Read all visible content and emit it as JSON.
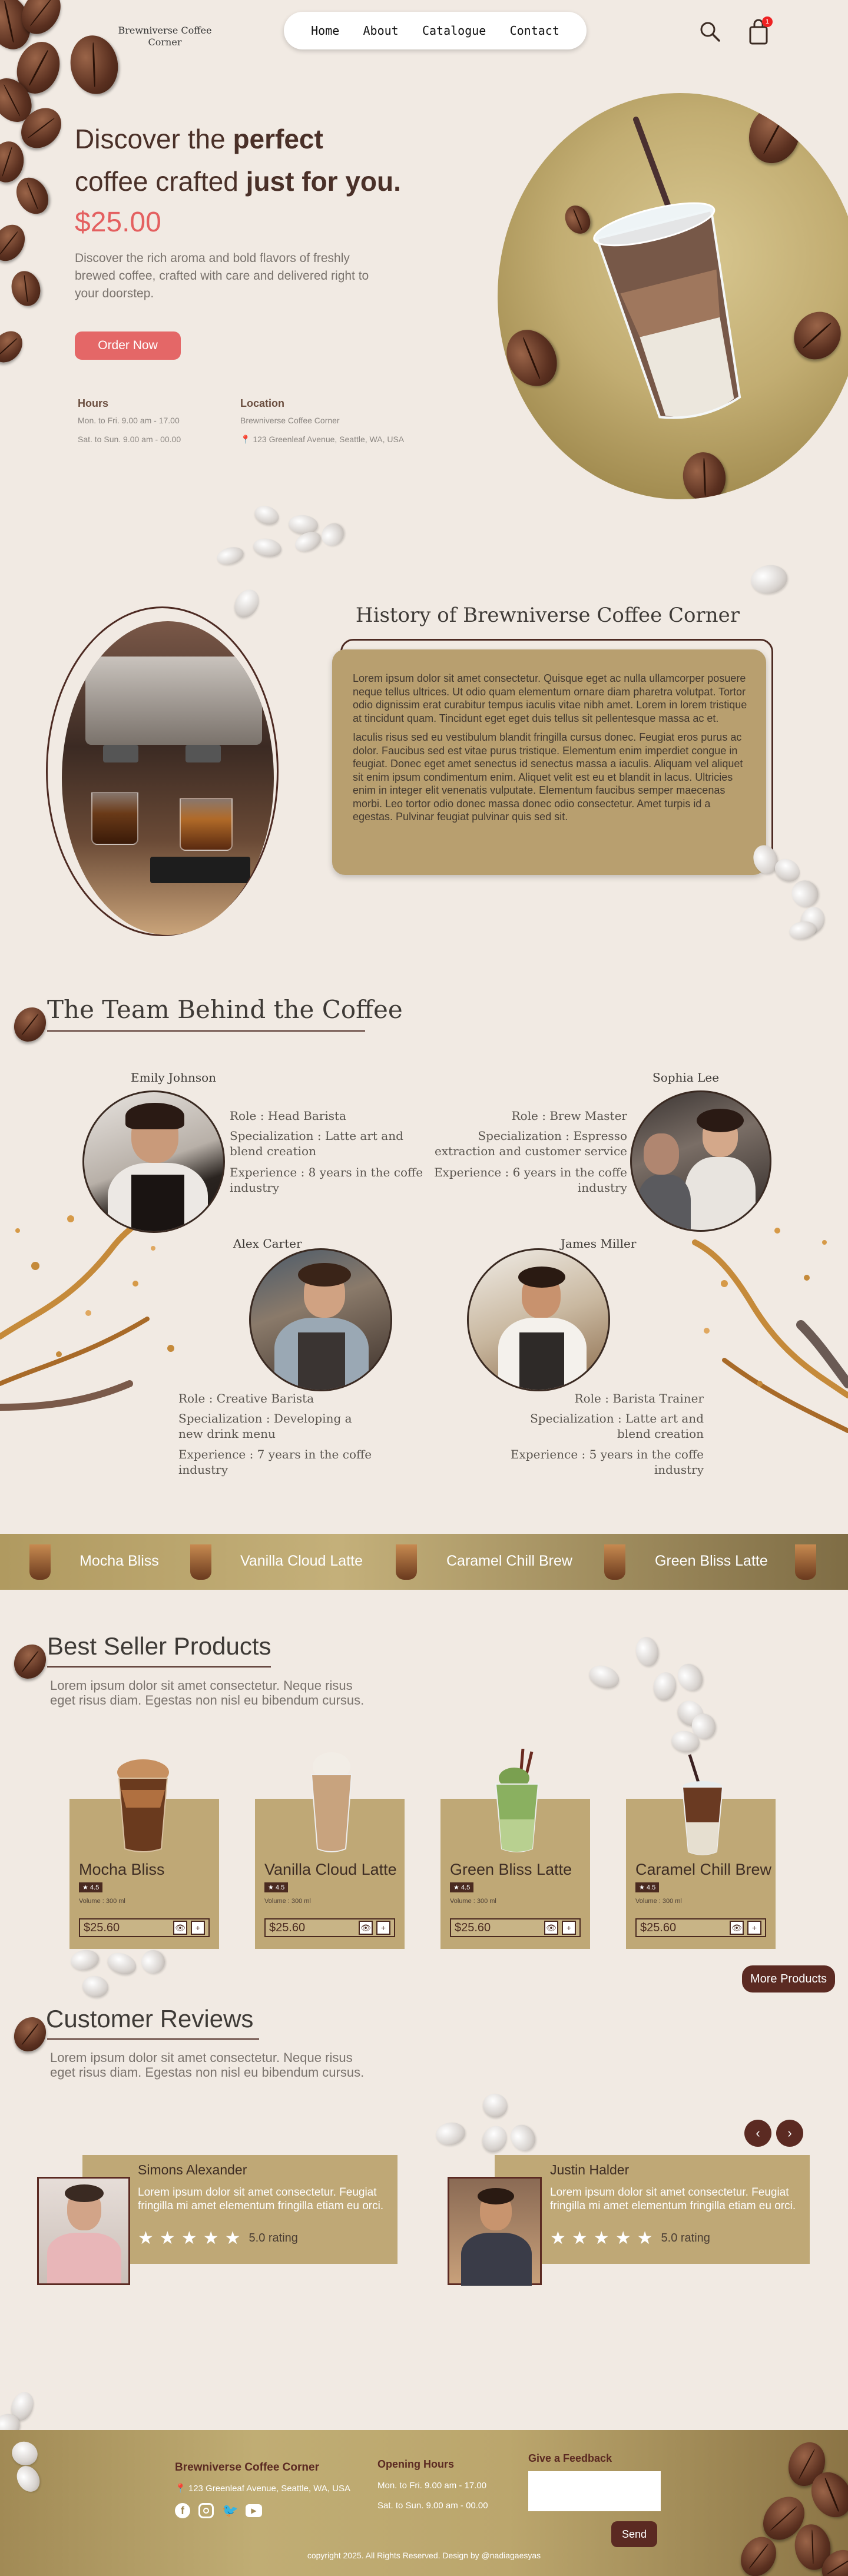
{
  "brand": {
    "name_line1": "Brewniverse Coffee",
    "name_line2": "Corner"
  },
  "nav": {
    "items": [
      "Home",
      "About",
      "Catalogue",
      "Contact"
    ],
    "cart_count": "1"
  },
  "hero": {
    "headline_1": "Discover the ",
    "headline_1_bold": "perfect",
    "headline_2": "coffee crafted ",
    "headline_2_bold": "just for you.",
    "price": "$25.00",
    "description": "Discover the rich aroma and bold flavors of freshly brewed coffee, crafted with care and delivered right to your doorstep.",
    "cta": "Order Now",
    "hours_title": "Hours",
    "hours_1": "Mon. to Fri. 9.00 am - 17.00",
    "hours_2": "Sat. to Sun. 9.00 am - 00.00",
    "location_title": "Location",
    "location_name": "Brewniverse Coffee Corner",
    "location_address": "123 Greenleaf Avenue, Seattle, WA, USA"
  },
  "history": {
    "title": "History of Brewniverse Coffee Corner",
    "p1": "Lorem ipsum dolor sit amet consectetur. Quisque eget ac nulla ullamcorper posuere neque tellus ultrices. Ut odio quam elementum ornare diam pharetra volutpat. Tortor odio dignissim erat curabitur tempus iaculis vitae nibh amet. Lorem in lorem tristique at tincidunt quam. Tincidunt eget eget duis tellus sit pellentesque massa ac et.",
    "p2": "Iaculis risus sed eu vestibulum blandit fringilla cursus donec. Feugiat eros purus ac dolor. Faucibus sed est vitae purus tristique. Elementum enim imperdiet congue in feugiat. Donec eget amet senectus id senectus massa a iaculis. Aliquam vel aliquet sit enim ipsum condimentum enim. Aliquet velit est eu et blandit in lacus. Ultricies enim in integer elit venenatis vulputate. Elementum faucibus semper maecenas morbi. Leo tortor odio donec massa donec odio consectetur. Amet turpis id a egestas. Pulvinar feugiat pulvinar quis sed sit."
  },
  "team": {
    "title": "The Team Behind the Coffee",
    "members": [
      {
        "name": "Emily Johnson",
        "role": "Role : Head Barista",
        "spec": "Specialization : Latte art and blend creation",
        "exp": "Experience : 8 years in the coffe industry"
      },
      {
        "name": "Sophia Lee",
        "role": "Role : Brew Master",
        "spec": "Specialization : Espresso extraction and customer service",
        "exp": "Experience : 6 years in the coffe industry"
      },
      {
        "name": "Alex Carter",
        "role": "Role : Creative Barista",
        "spec": "Specialization : Developing a new drink menu",
        "exp": "Experience : 7 years in the coffe industry"
      },
      {
        "name": "James Miller",
        "role": "Role : Barista Trainer",
        "spec": "Specialization : Latte art and blend creation",
        "exp": "Experience : 5 years in the coffe industry"
      }
    ]
  },
  "band": {
    "items": [
      "Mocha Bliss",
      "Vanilla Cloud Latte",
      "Caramel Chill Brew",
      "Green Bliss Latte"
    ]
  },
  "products": {
    "title": "Best Seller Products",
    "subtitle": "Lorem ipsum dolor sit amet consectetur. Neque risus eget risus diam. Egestas non nisl eu bibendum cursus.",
    "items": [
      {
        "name": "Mocha Bliss",
        "rating": "★ 4.5",
        "volume": "Volume : 300 ml",
        "price": "$25.60"
      },
      {
        "name": "Vanilla Cloud Latte",
        "rating": "★ 4.5",
        "volume": "Volume : 300 ml",
        "price": "$25.60"
      },
      {
        "name": "Green Bliss Latte",
        "rating": "★ 4.5",
        "volume": "Volume : 300 ml",
        "price": "$25.60"
      },
      {
        "name": "Caramel Chill Brew",
        "rating": "★ 4.5",
        "volume": "Volume : 300 ml",
        "price": "$25.60"
      }
    ],
    "more": "More Products"
  },
  "reviews": {
    "title": "Customer Reviews",
    "subtitle": "Lorem ipsum dolor sit amet consectetur. Neque risus eget risus diam. Egestas non nisl eu bibendum cursus.",
    "items": [
      {
        "name": "Simons Alexander",
        "text": "Lorem ipsum dolor sit amet consectetur. Feugiat fringilla mi amet elementum fringilla etiam eu orci.",
        "rating": "5.0 rating"
      },
      {
        "name": "Justin Halder",
        "text": "Lorem ipsum dolor sit amet consectetur. Feugiat fringilla mi amet elementum fringilla etiam eu orci.",
        "rating": "5.0 rating"
      }
    ],
    "prev": "‹",
    "next": "›"
  },
  "footer": {
    "brand": "Brewniverse Coffee Corner",
    "address": "123 Greenleaf Avenue, Seattle, WA, USA",
    "hours_title": "Opening Hours",
    "hours_1": "Mon. to Fri. 9.00 am - 17.00",
    "hours_2": "Sat. to Sun. 9.00 am - 00.00",
    "feedback_title": "Give a Feedback",
    "send": "Send",
    "copyright": "copyright 2025. All Rights Reserved. Design by @nadiagaesyas"
  },
  "colors": {
    "accent": "#e46767",
    "brown": "#5b2a22",
    "card": "#bfa876",
    "bg": "#f1eae3"
  }
}
